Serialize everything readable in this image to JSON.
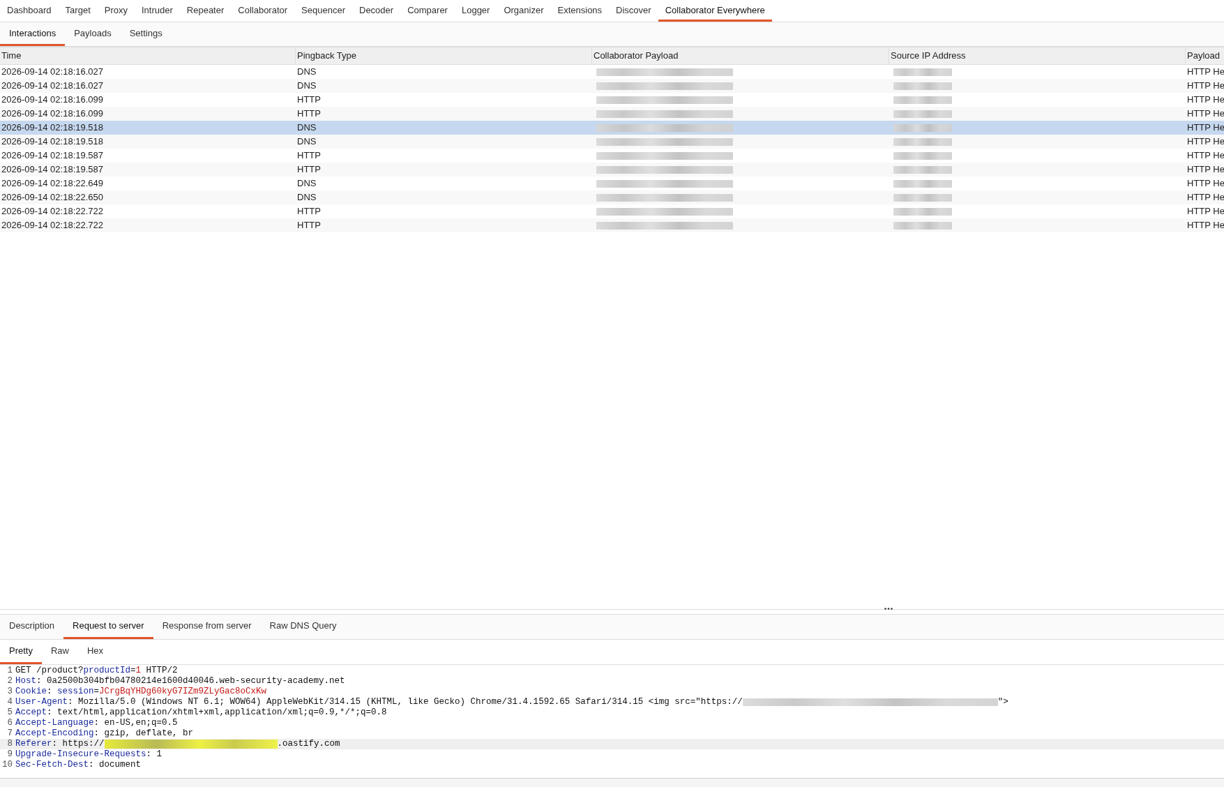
{
  "main_tabs": [
    {
      "label": "Dashboard",
      "selected": false
    },
    {
      "label": "Target",
      "selected": false
    },
    {
      "label": "Proxy",
      "selected": false
    },
    {
      "label": "Intruder",
      "selected": false
    },
    {
      "label": "Repeater",
      "selected": false
    },
    {
      "label": "Collaborator",
      "selected": false
    },
    {
      "label": "Sequencer",
      "selected": false
    },
    {
      "label": "Decoder",
      "selected": false
    },
    {
      "label": "Comparer",
      "selected": false
    },
    {
      "label": "Logger",
      "selected": false
    },
    {
      "label": "Organizer",
      "selected": false
    },
    {
      "label": "Extensions",
      "selected": false
    },
    {
      "label": "Discover",
      "selected": false
    },
    {
      "label": "Collaborator Everywhere",
      "selected": true
    }
  ],
  "sub_tabs": [
    {
      "label": "Interactions",
      "selected": true
    },
    {
      "label": "Payloads",
      "selected": false
    },
    {
      "label": "Settings",
      "selected": false
    }
  ],
  "table": {
    "columns": [
      "Time",
      "Pingback Type",
      "Collaborator Payload",
      "Source IP Address",
      "Payload"
    ],
    "rows": [
      {
        "time": "2026-09-14 02:18:16.027",
        "type": "DNS",
        "payload_type": "HTTP He",
        "selected": false
      },
      {
        "time": "2026-09-14 02:18:16.027",
        "type": "DNS",
        "payload_type": "HTTP He",
        "selected": false
      },
      {
        "time": "2026-09-14 02:18:16.099",
        "type": "HTTP",
        "payload_type": "HTTP He",
        "selected": false
      },
      {
        "time": "2026-09-14 02:18:16.099",
        "type": "HTTP",
        "payload_type": "HTTP He",
        "selected": false
      },
      {
        "time": "2026-09-14 02:18:19.518",
        "type": "DNS",
        "payload_type": "HTTP He",
        "selected": true
      },
      {
        "time": "2026-09-14 02:18:19.518",
        "type": "DNS",
        "payload_type": "HTTP He",
        "selected": false
      },
      {
        "time": "2026-09-14 02:18:19.587",
        "type": "HTTP",
        "payload_type": "HTTP He",
        "selected": false
      },
      {
        "time": "2026-09-14 02:18:19.587",
        "type": "HTTP",
        "payload_type": "HTTP He",
        "selected": false
      },
      {
        "time": "2026-09-14 02:18:22.649",
        "type": "DNS",
        "payload_type": "HTTP He",
        "selected": false
      },
      {
        "time": "2026-09-14 02:18:22.650",
        "type": "DNS",
        "payload_type": "HTTP He",
        "selected": false
      },
      {
        "time": "2026-09-14 02:18:22.722",
        "type": "HTTP",
        "payload_type": "HTTP He",
        "selected": false
      },
      {
        "time": "2026-09-14 02:18:22.722",
        "type": "HTTP",
        "payload_type": "HTTP He",
        "selected": false
      }
    ]
  },
  "detail_tabs": [
    {
      "label": "Description",
      "selected": false
    },
    {
      "label": "Request to server",
      "selected": true
    },
    {
      "label": "Response from server",
      "selected": false
    },
    {
      "label": "Raw DNS Query",
      "selected": false
    }
  ],
  "view_tabs": [
    {
      "label": "Pretty",
      "selected": true
    },
    {
      "label": "Raw",
      "selected": false
    },
    {
      "label": "Hex",
      "selected": false
    }
  ],
  "code_lines": [
    {
      "number": "1",
      "current": false,
      "segments": [
        {
          "kind": "plain",
          "text": "GET /product?"
        },
        {
          "kind": "name",
          "text": "productId"
        },
        {
          "kind": "plain",
          "text": "="
        },
        {
          "kind": "param",
          "text": "1"
        },
        {
          "kind": "plain",
          "text": " HTTP/2"
        }
      ]
    },
    {
      "number": "2",
      "current": false,
      "segments": [
        {
          "kind": "name",
          "text": "Host"
        },
        {
          "kind": "plain",
          "text": ": 0a2500b304bfb04780214e1600d40046.web-security-academy.net"
        }
      ]
    },
    {
      "number": "3",
      "current": false,
      "segments": [
        {
          "kind": "name",
          "text": "Cookie"
        },
        {
          "kind": "plain",
          "text": ": "
        },
        {
          "kind": "name",
          "text": "session"
        },
        {
          "kind": "plain",
          "text": "="
        },
        {
          "kind": "param",
          "text": "JCrgBqYHDg60kyG7IZm9ZLyGac8oCxKw"
        }
      ]
    },
    {
      "number": "4",
      "current": false,
      "segments": [
        {
          "kind": "name",
          "text": "User-Agent"
        },
        {
          "kind": "plain",
          "text": ": Mozilla/5.0 (Windows NT 6.1; WOW64) AppleWebKit/314.15 (KHTML, like Gecko) Chrome/31.4.1592.65 Safari/314.15 <img src=\"https://"
        },
        {
          "kind": "redacted"
        },
        {
          "kind": "plain",
          "text": "\">"
        }
      ]
    },
    {
      "number": "5",
      "current": false,
      "segments": [
        {
          "kind": "name",
          "text": "Accept"
        },
        {
          "kind": "plain",
          "text": ": text/html,application/xhtml+xml,application/xml;q=0.9,*/*;q=0.8"
        }
      ]
    },
    {
      "number": "6",
      "current": false,
      "segments": [
        {
          "kind": "name",
          "text": "Accept-Language"
        },
        {
          "kind": "plain",
          "text": ": en-US,en;q=0.5"
        }
      ]
    },
    {
      "number": "7",
      "current": false,
      "segments": [
        {
          "kind": "name",
          "text": "Accept-Encoding"
        },
        {
          "kind": "plain",
          "text": ": gzip, deflate, br"
        }
      ]
    },
    {
      "number": "8",
      "current": true,
      "segments": [
        {
          "kind": "name",
          "text": "Referer"
        },
        {
          "kind": "plain",
          "text": ": https://"
        },
        {
          "kind": "highlighted_redacted"
        },
        {
          "kind": "plain",
          "text": ".oastify.com"
        }
      ]
    },
    {
      "number": "9",
      "current": false,
      "segments": [
        {
          "kind": "name",
          "text": "Upgrade-Insecure-Requests"
        },
        {
          "kind": "plain",
          "text": ": 1"
        }
      ]
    },
    {
      "number": "10",
      "current": false,
      "segments": [
        {
          "kind": "name",
          "text": "Sec-Fetch-Dest"
        },
        {
          "kind": "plain",
          "text": ": document"
        }
      ]
    }
  ]
}
